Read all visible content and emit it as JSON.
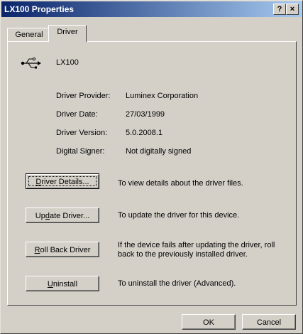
{
  "window": {
    "title": "LX100 Properties",
    "help_label": "?",
    "close_label": "×"
  },
  "tabs": [
    {
      "label": "General",
      "selected": false
    },
    {
      "label": "Driver",
      "selected": true
    }
  ],
  "device": {
    "icon": "usb-icon",
    "name": "LX100"
  },
  "info": [
    {
      "label": "Driver Provider:",
      "value": "Luminex Corporation"
    },
    {
      "label": "Driver Date:",
      "value": "27/03/1999"
    },
    {
      "label": "Driver Version:",
      "value": "5.0.2008.1"
    },
    {
      "label": "Digital Signer:",
      "value": "Not digitally signed"
    }
  ],
  "buttons": {
    "details": {
      "pre": "",
      "accel": "D",
      "post": "river Details...",
      "desc": "To view details about the driver files."
    },
    "update": {
      "pre": "Up",
      "accel": "d",
      "post": "ate Driver...",
      "desc": "To update the driver for this device."
    },
    "rollback": {
      "pre": "",
      "accel": "R",
      "post": "oll Back Driver",
      "desc": "If the device fails after updating the driver, roll back to the previously installed driver."
    },
    "uninstall": {
      "pre": "",
      "accel": "U",
      "post": "ninstall",
      "desc": "To uninstall the driver (Advanced)."
    }
  },
  "footer": {
    "ok_label": "OK",
    "cancel_label": "Cancel"
  }
}
